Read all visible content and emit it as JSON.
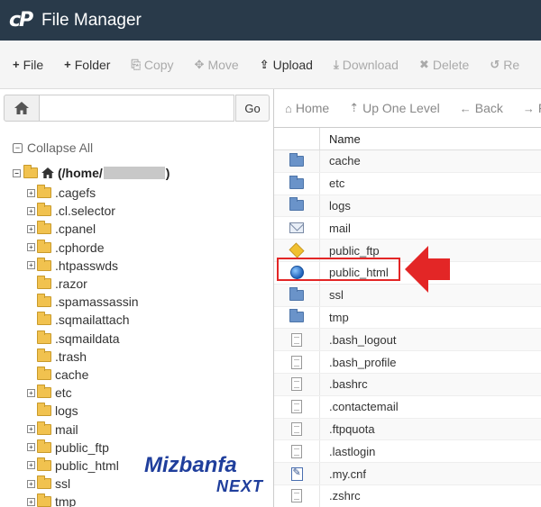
{
  "header": {
    "logo": "cP",
    "title": "File Manager"
  },
  "toolbar": {
    "buttons": [
      {
        "label": "File",
        "icon": "plus-icon",
        "disabled": false
      },
      {
        "label": "Folder",
        "icon": "plus-icon",
        "disabled": false
      },
      {
        "label": "Copy",
        "icon": "copy-icon",
        "disabled": true
      },
      {
        "label": "Move",
        "icon": "move-icon",
        "disabled": true
      },
      {
        "label": "Upload",
        "icon": "upload-icon",
        "disabled": false
      },
      {
        "label": "Download",
        "icon": "download-icon",
        "disabled": true
      },
      {
        "label": "Delete",
        "icon": "delete-icon",
        "disabled": true
      },
      {
        "label": "Re",
        "icon": "restore-icon",
        "disabled": true
      }
    ]
  },
  "left": {
    "path_value": "",
    "go_label": "Go",
    "collapse_all": "Collapse All",
    "root_prefix": "(/home/",
    "root_suffix": ")",
    "tree": [
      {
        "label": ".cagefs",
        "expandable": true
      },
      {
        "label": ".cl.selector",
        "expandable": true
      },
      {
        "label": ".cpanel",
        "expandable": true
      },
      {
        "label": ".cphorde",
        "expandable": true
      },
      {
        "label": ".htpasswds",
        "expandable": true
      },
      {
        "label": ".razor",
        "expandable": false
      },
      {
        "label": ".spamassassin",
        "expandable": false
      },
      {
        "label": ".sqmailattach",
        "expandable": false
      },
      {
        "label": ".sqmaildata",
        "expandable": false
      },
      {
        "label": ".trash",
        "expandable": false
      },
      {
        "label": "cache",
        "expandable": false
      },
      {
        "label": "etc",
        "expandable": true
      },
      {
        "label": "logs",
        "expandable": false
      },
      {
        "label": "mail",
        "expandable": true
      },
      {
        "label": "public_ftp",
        "expandable": true
      },
      {
        "label": "public_html",
        "expandable": true
      },
      {
        "label": "ssl",
        "expandable": true
      },
      {
        "label": "tmp",
        "expandable": true
      }
    ]
  },
  "watermark": {
    "line1": "Mizbanfa",
    "line2": "NEXT",
    "color": "#1f3e9c"
  },
  "right_toolbar": {
    "buttons": [
      {
        "label": "Home",
        "icon": "home-icon"
      },
      {
        "label": "Up One Level",
        "icon": "up-level-icon"
      },
      {
        "label": "Back",
        "icon": "back-icon"
      },
      {
        "label": "F",
        "icon": "forward-icon"
      }
    ]
  },
  "table": {
    "header": "Name",
    "rows": [
      {
        "name": "cache",
        "icon": "folder"
      },
      {
        "name": "etc",
        "icon": "folder"
      },
      {
        "name": "logs",
        "icon": "folder"
      },
      {
        "name": "mail",
        "icon": "mail"
      },
      {
        "name": "public_ftp",
        "icon": "ftp"
      },
      {
        "name": "public_html",
        "icon": "globe"
      },
      {
        "name": "ssl",
        "icon": "folder"
      },
      {
        "name": "tmp",
        "icon": "folder"
      },
      {
        "name": ".bash_logout",
        "icon": "file"
      },
      {
        "name": ".bash_profile",
        "icon": "file"
      },
      {
        "name": ".bashrc",
        "icon": "file"
      },
      {
        "name": ".contactemail",
        "icon": "file"
      },
      {
        "name": ".ftpquota",
        "icon": "file"
      },
      {
        "name": ".lastlogin",
        "icon": "file"
      },
      {
        "name": ".my.cnf",
        "icon": "cnf"
      },
      {
        "name": ".zshrc",
        "icon": "file"
      }
    ]
  },
  "colors": {
    "header_bg": "#293a4a",
    "highlight": "#e32626"
  }
}
